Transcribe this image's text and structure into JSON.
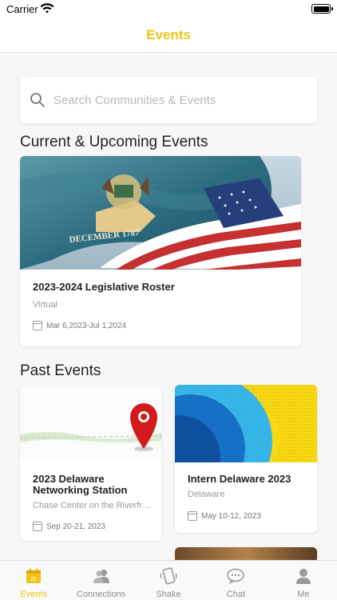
{
  "status_bar": {
    "carrier": "Carrier"
  },
  "header": {
    "title": "Events"
  },
  "search": {
    "placeholder": "Search Communities & Events"
  },
  "sections": {
    "upcoming_title": "Current & Upcoming Events",
    "past_title": "Past Events"
  },
  "upcoming_events": [
    {
      "title": "2023-2024 Legislative Roster",
      "location": "Virtual",
      "date": "Mar  6,2023-Jul  1,2024",
      "image_text": "DECEMBER  1787"
    }
  ],
  "past_events": [
    {
      "title": "2023 Delaware Networking Station",
      "location": "Chase Center on the Riverfr…",
      "date": "Sep 20-21, 2023"
    },
    {
      "title": "Intern Delaware 2023",
      "location": "Delaware",
      "date": "May 10-12, 2023"
    }
  ],
  "tab_bar": {
    "tabs": [
      {
        "label": "Events",
        "icon": "calendar-icon",
        "active": true,
        "badge": "21"
      },
      {
        "label": "Connections",
        "icon": "people-icon",
        "active": false
      },
      {
        "label": "Shake",
        "icon": "phone-shake-icon",
        "active": false
      },
      {
        "label": "Chat",
        "icon": "chat-bubble-icon",
        "active": false
      },
      {
        "label": "Me",
        "icon": "person-icon",
        "active": false
      }
    ]
  },
  "colors": {
    "accent": "#f0c419",
    "background": "#f7f7f7",
    "tab_inactive": "#8e8e8e"
  }
}
